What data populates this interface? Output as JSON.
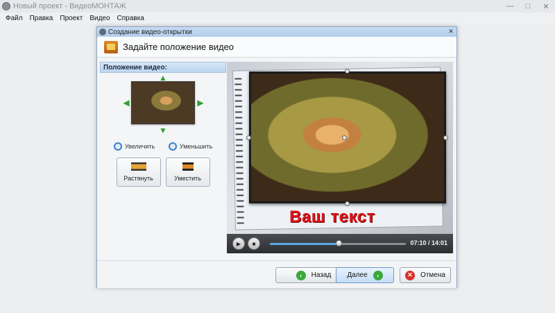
{
  "app": {
    "title": "Новый проект - ВидеоМОНТАЖ",
    "menu": [
      "Файл",
      "Правка",
      "Проект",
      "Видео",
      "Справка"
    ]
  },
  "dialog": {
    "title": "Создание видео-открытки",
    "header": "Задайте положение видео",
    "position_section_title": "Положение видео:",
    "zoom_in_label": "Увеличить",
    "zoom_out_label": "Уменьшить",
    "stretch_label": "Растянуть",
    "fit_label": "Уместить",
    "overlay_text": "Ваш текст",
    "player": {
      "timecode": "07:10 / 14:01",
      "progress": 0.51
    },
    "buttons": {
      "back": "Назад",
      "next": "Далее",
      "cancel": "Отмена"
    }
  },
  "colors": {
    "accent": "#58a8e8",
    "overlay_text": "#e0141b",
    "green_icon": "#3aa83a",
    "red_icon": "#d9312a"
  },
  "icons": {
    "move_up": "arrow-up-icon",
    "move_down": "arrow-down-icon",
    "move_left": "arrow-left-icon",
    "move_right": "arrow-right-icon"
  }
}
